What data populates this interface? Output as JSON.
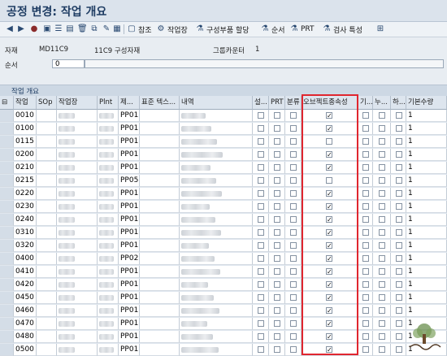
{
  "window": {
    "title": "공정 변경: 작업 개요"
  },
  "toolbar": {
    "reference": "참조",
    "work_center": "작업장",
    "component_alloc": "구성부품 할당",
    "sequence": "순서",
    "prt": "PRT",
    "inspection": "검사 특성"
  },
  "header": {
    "material_label": "자재",
    "material_value": "MD11C9",
    "material_desc": "11C9 구성자재",
    "group_counter_label": "그룹카운터",
    "group_counter_value": "1",
    "sequence_label": "순서",
    "sequence_value": "0"
  },
  "panel": {
    "title": "작업 개요"
  },
  "columns": [
    "작업",
    "SOp",
    "작업장",
    "Plnt",
    "제...",
    "표준 텍스...",
    "내역",
    "설...",
    "PRT",
    "분류",
    "오브젝트종속성",
    "기...",
    "누...",
    "하...",
    "기본수량"
  ],
  "rows": [
    {
      "op": "0010",
      "ctrl": "PP01",
      "obj": true,
      "qty": "1"
    },
    {
      "op": "0100",
      "ctrl": "PP01",
      "obj": true,
      "qty": "1"
    },
    {
      "op": "0115",
      "ctrl": "PP01",
      "obj": false,
      "qty": "1"
    },
    {
      "op": "0200",
      "ctrl": "PP01",
      "obj": true,
      "qty": "1"
    },
    {
      "op": "0210",
      "ctrl": "PP01",
      "obj": true,
      "qty": "1"
    },
    {
      "op": "0215",
      "ctrl": "PP05",
      "obj": false,
      "qty": "1"
    },
    {
      "op": "0220",
      "ctrl": "PP01",
      "obj": true,
      "qty": "1"
    },
    {
      "op": "0230",
      "ctrl": "PP01",
      "obj": true,
      "qty": "1"
    },
    {
      "op": "0240",
      "ctrl": "PP01",
      "obj": true,
      "qty": "1"
    },
    {
      "op": "0310",
      "ctrl": "PP01",
      "obj": true,
      "qty": "1"
    },
    {
      "op": "0320",
      "ctrl": "PP01",
      "obj": true,
      "qty": "1"
    },
    {
      "op": "0400",
      "ctrl": "PP02",
      "obj": true,
      "qty": "1"
    },
    {
      "op": "0410",
      "ctrl": "PP01",
      "obj": true,
      "qty": "1"
    },
    {
      "op": "0420",
      "ctrl": "PP01",
      "obj": true,
      "qty": "1"
    },
    {
      "op": "0450",
      "ctrl": "PP01",
      "obj": true,
      "qty": "1"
    },
    {
      "op": "0460",
      "ctrl": "PP01",
      "obj": true,
      "qty": "1"
    },
    {
      "op": "0470",
      "ctrl": "PP01",
      "obj": true,
      "qty": "1"
    },
    {
      "op": "0480",
      "ctrl": "PP01",
      "obj": true,
      "qty": "1"
    },
    {
      "op": "0500",
      "ctrl": "PP01",
      "obj": true,
      "qty": "1"
    }
  ],
  "highlight_color": "#e0262f"
}
